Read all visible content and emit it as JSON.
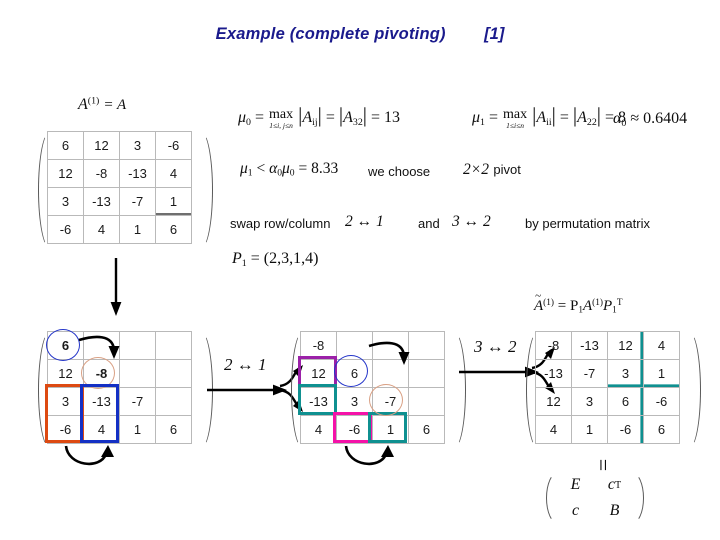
{
  "title": {
    "text": "Example (complete pivoting)",
    "reference": "[1]",
    "color": "#1a1a8c"
  },
  "formulas": {
    "a1_label": "A",
    "a1_sup": "(1)",
    "a1_eq": "= A",
    "mu0": {
      "symbol": "μ",
      "sub": "0",
      "eq1": "=",
      "op": "max",
      "op_range": "1≤i, j≤n",
      "arg": "A",
      "arg_sub": "ij",
      "eq2": "=",
      "arg2": "A",
      "arg2_sub": "32",
      "eq3": "= 13"
    },
    "mu1": {
      "symbol": "μ",
      "sub": "1",
      "eq1": "=",
      "op": "max",
      "op_range": "1≤i≤n",
      "arg": "A",
      "arg_sub": "ii",
      "eq2": "=",
      "arg2": "A",
      "arg2_sub": "22",
      "eq3": "= 8"
    },
    "alpha0": {
      "symbol": "α",
      "sub": "0",
      "rest": "≈ 0.6404"
    },
    "inequality": {
      "mu1": "μ",
      "mu1_sub": "1",
      "lt": "<",
      "alpha": "α",
      "alpha_sub": "0",
      "mu0": "μ",
      "mu0_sub": "0",
      "value": "= 8.33"
    },
    "we_choose": "we choose",
    "pivot_size": "2×2",
    "pivot_word": "pivot",
    "swap_text": "swap row/column",
    "swap_1": "2 ↔ 1",
    "and_text": "and",
    "swap_2": "3 ↔ 2",
    "perm_text": "by permutation matrix",
    "p1": {
      "symbol": "P",
      "sub": "1",
      "value": "= (2,3,1,4)"
    },
    "a_tilde": {
      "lhs": "A",
      "lhs_sup": "(1)",
      "rhs": "= P",
      "rhs_sub1": "1",
      "rhs_a": "A",
      "rhs_a_sup": "(1)",
      "rhs_p": "P",
      "rhs_p_sub": "1",
      "rhs_p_sup": "T"
    },
    "arrow_21": "2 ↔ 1",
    "arrow_32": "3 ↔ 2",
    "equals_sign": "=",
    "block": {
      "e": "E",
      "ct": "c",
      "ct_sup": "T",
      "c": "c",
      "b": "B"
    }
  },
  "matrices": {
    "original": {
      "name": "A-one",
      "rows": [
        [
          {
            "v": "6",
            "s": "plain"
          },
          {
            "v": "12",
            "s": "faded"
          },
          {
            "v": "3",
            "s": "plain"
          },
          {
            "v": "-6",
            "s": "faded"
          }
        ],
        [
          {
            "v": "12",
            "s": "plain"
          },
          {
            "v": "-8",
            "s": "blue"
          },
          {
            "v": "-13",
            "s": "faded"
          },
          {
            "v": "4",
            "s": "faded"
          }
        ],
        [
          {
            "v": "3",
            "s": "plain"
          },
          {
            "v": "-13",
            "s": "orange"
          },
          {
            "v": "-7",
            "s": "plain"
          },
          {
            "v": "1",
            "s": "faded darkbot"
          }
        ],
        [
          {
            "v": "-6",
            "s": "plain"
          },
          {
            "v": "4",
            "s": "plain"
          },
          {
            "v": "1",
            "s": "plain"
          },
          {
            "v": "6",
            "s": "plain"
          }
        ]
      ]
    },
    "step1": {
      "name": "A-one-marked",
      "rows": [
        [
          {
            "v": "6",
            "s": "boldc"
          },
          {
            "v": "",
            "s": "plain"
          },
          {
            "v": "",
            "s": "plain"
          },
          {
            "v": "",
            "s": "plain"
          }
        ],
        [
          {
            "v": "12",
            "s": "plain"
          },
          {
            "v": "-8",
            "s": "boldc"
          },
          {
            "v": "",
            "s": "plain"
          },
          {
            "v": "",
            "s": "plain"
          }
        ],
        [
          {
            "v": "3",
            "s": "plain"
          },
          {
            "v": "-13",
            "s": "plain"
          },
          {
            "v": "-7",
            "s": "plain"
          },
          {
            "v": "",
            "s": "plain"
          }
        ],
        [
          {
            "v": "-6",
            "s": "plain"
          },
          {
            "v": "4",
            "s": "plain"
          },
          {
            "v": "1",
            "s": "plain"
          },
          {
            "v": "6",
            "s": "plain"
          }
        ]
      ],
      "circle_6_color": "#2435c9",
      "circle_m8_color": "#d9a084",
      "box_col1_color": "#dd4a12",
      "box_col2_color": "#1430c4"
    },
    "step2": {
      "name": "A-after-swap-21",
      "rows": [
        [
          {
            "v": "-8",
            "s": "plain"
          },
          {
            "v": "",
            "s": "plain"
          },
          {
            "v": "",
            "s": "plain"
          },
          {
            "v": "",
            "s": "plain"
          }
        ],
        [
          {
            "v": "12",
            "s": "plain"
          },
          {
            "v": "6",
            "s": "plain"
          },
          {
            "v": "",
            "s": "plain"
          },
          {
            "v": "",
            "s": "plain"
          }
        ],
        [
          {
            "v": "-13",
            "s": "plain"
          },
          {
            "v": "3",
            "s": "plain"
          },
          {
            "v": "-7",
            "s": "plain"
          },
          {
            "v": "",
            "s": "plain"
          }
        ],
        [
          {
            "v": "4",
            "s": "plain"
          },
          {
            "v": "-6",
            "s": "plain"
          },
          {
            "v": "1",
            "s": "plain"
          },
          {
            "v": "6",
            "s": "plain"
          }
        ]
      ],
      "box_purple": "#9b21a8",
      "box_teal": "#0f9090",
      "box_magenta": "#f412a8",
      "circle_6_color": "#2435c9",
      "circle_m7_color": "#d9a084"
    },
    "final": {
      "name": "A-tilde-one",
      "rows": [
        [
          {
            "v": "-8",
            "s": "plain"
          },
          {
            "v": "-13",
            "s": "faded"
          },
          {
            "v": "12",
            "s": "faded tealright"
          },
          {
            "v": "4",
            "s": "faded"
          }
        ],
        [
          {
            "v": "-13",
            "s": "orange"
          },
          {
            "v": "-7",
            "s": "plain"
          },
          {
            "v": "3",
            "s": "faded tealrb"
          },
          {
            "v": "1",
            "s": "faded tealbot"
          }
        ],
        [
          {
            "v": "12",
            "s": "plain"
          },
          {
            "v": "3",
            "s": "plain"
          },
          {
            "v": "6",
            "s": "plain tealright"
          },
          {
            "v": "-6",
            "s": "faded"
          }
        ],
        [
          {
            "v": "4",
            "s": "plain"
          },
          {
            "v": "1",
            "s": "plain"
          },
          {
            "v": "-6",
            "s": "plain tealright"
          },
          {
            "v": "6",
            "s": "plain"
          }
        ]
      ],
      "separator_color": "#0f9090"
    }
  }
}
